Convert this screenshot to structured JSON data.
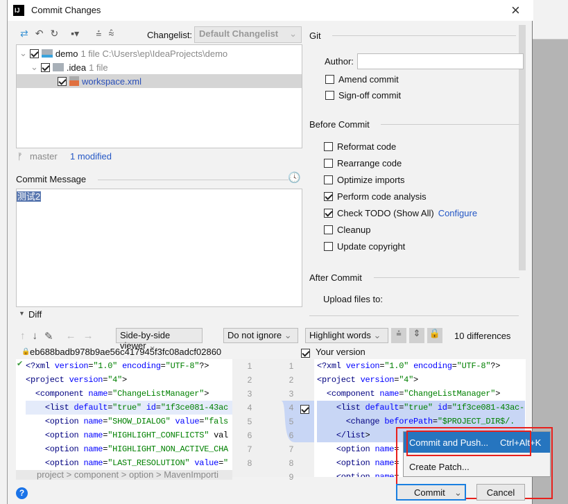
{
  "window": {
    "title": "Commit Changes",
    "close": "×"
  },
  "toolbar": {
    "changelist_label": "Changelist:",
    "changelist_value": "Default Changelist"
  },
  "tree": [
    {
      "name": "demo",
      "meta": "1 file  C:\\Users\\ep\\IdeaProjects\\demo",
      "checked": true
    },
    {
      "name": ".idea",
      "meta": "1 file",
      "checked": true
    },
    {
      "name": "workspace.xml",
      "meta": "",
      "checked": true
    }
  ],
  "status": {
    "branch": "master",
    "modified": "1 modified"
  },
  "commit_message": {
    "label": "Commit Message",
    "value": "测试2"
  },
  "git": {
    "header": "Git",
    "author_label": "Author:",
    "author_value": "",
    "amend": "Amend commit",
    "signoff": "Sign-off commit"
  },
  "before_commit": {
    "header": "Before Commit",
    "options": [
      {
        "label": "Reformat code",
        "checked": false
      },
      {
        "label": "Rearrange code",
        "checked": false
      },
      {
        "label": "Optimize imports",
        "checked": false
      },
      {
        "label": "Perform code analysis",
        "checked": true
      },
      {
        "label": "Check TODO (Show All)",
        "checked": true,
        "link": "Configure"
      },
      {
        "label": "Cleanup",
        "checked": false
      },
      {
        "label": "Update copyright",
        "checked": false
      }
    ]
  },
  "after_commit": {
    "header": "After Commit",
    "upload": "Upload files to:"
  },
  "diff": {
    "header": "Diff",
    "viewer": "Side-by-side viewer",
    "ignore": "Do not ignore",
    "highlight": "Highlight words",
    "differences": "10 differences",
    "left_title": "eb688badb978b9ae56c417945f3fc08adcf02860",
    "right_title": "Your version",
    "breadcrumb": "project > component > option > MavenImporti",
    "left_lines": [
      "<?xml version=\"1.0\" encoding=\"UTF-8\"?>",
      "<project version=\"4\">",
      "  <component name=\"ChangeListManager\">",
      "    <list default=\"true\" id=\"1f3ce081-43ac",
      "    <option name=\"SHOW_DIALOG\" value=\"fals",
      "    <option name=\"HIGHLIGHT_CONFLICTS\" val",
      "    <option name=\"HIGHLIGHT_NON_ACTIVE_CHA",
      "    <option name=\"LAST_RESOLUTION\" value=\""
    ],
    "right_lines": [
      "<?xml version=\"1.0\" encoding=\"UTF-8\"?>",
      "<project version=\"4\">",
      "  <component name=\"ChangeListManager\">",
      "    <list default=\"true\" id=\"1f3ce081-43ac-",
      "      <change beforePath=\"$PROJECT_DIR$/.",
      "    </list>",
      "    <option name=",
      "    <option name=",
      "    <option name="
    ],
    "left_nums": [
      "1",
      "2",
      "3",
      "4",
      "5",
      "6",
      "7",
      "8"
    ],
    "right_nums": [
      "1",
      "2",
      "3",
      "4",
      "5",
      "6",
      "7",
      "8",
      "9"
    ]
  },
  "popup": {
    "items": [
      {
        "label": "Commit and Push...",
        "shortcut": "Ctrl+Alt+K"
      },
      {
        "label": "Create Patch..."
      }
    ]
  },
  "buttons": {
    "commit": "Commit",
    "cancel": "Cancel",
    "help": "?"
  },
  "colors": {
    "accent": "#2675bf",
    "highlight_red": "#e8201c",
    "link": "#2457c5"
  }
}
